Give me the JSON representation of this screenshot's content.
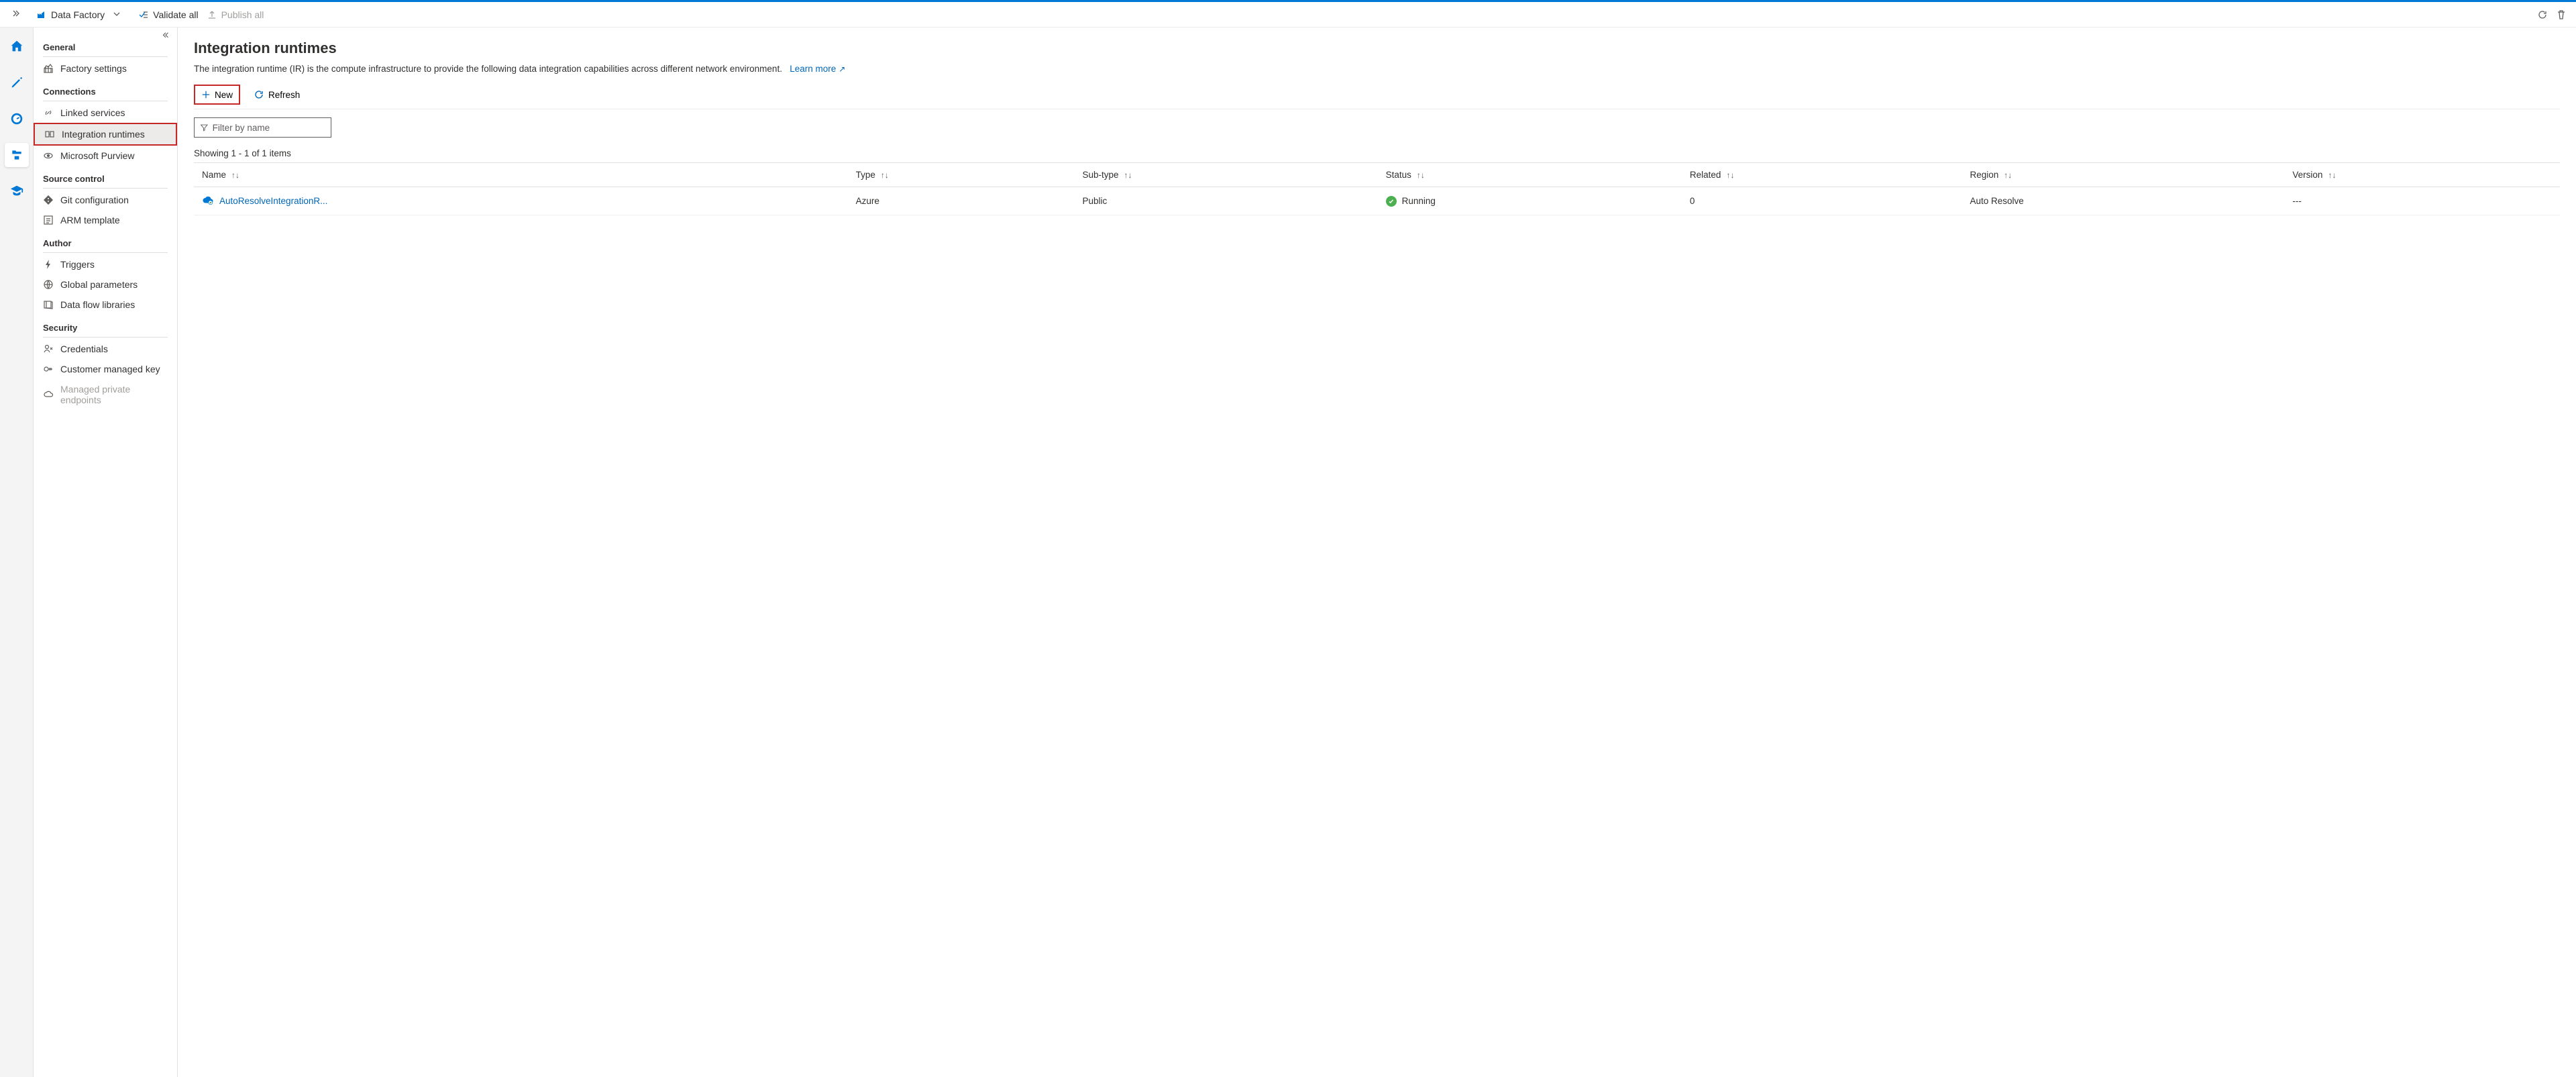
{
  "toolbar": {
    "context_label": "Data Factory",
    "validate_all": "Validate all",
    "publish_all": "Publish all"
  },
  "mgmt": {
    "sections": {
      "general": {
        "title": "General",
        "items": [
          "Factory settings"
        ]
      },
      "connections": {
        "title": "Connections",
        "items": [
          "Linked services",
          "Integration runtimes",
          "Microsoft Purview"
        ]
      },
      "source_control": {
        "title": "Source control",
        "items": [
          "Git configuration",
          "ARM template"
        ]
      },
      "author": {
        "title": "Author",
        "items": [
          "Triggers",
          "Global parameters",
          "Data flow libraries"
        ]
      },
      "security": {
        "title": "Security",
        "items": [
          "Credentials",
          "Customer managed key",
          "Managed private endpoints"
        ]
      }
    }
  },
  "page": {
    "title": "Integration runtimes",
    "description": "The integration runtime (IR) is the compute infrastructure to provide the following data integration capabilities across different network environment.",
    "learn_more": "Learn more"
  },
  "actions": {
    "new": "New",
    "refresh": "Refresh"
  },
  "filter": {
    "placeholder": "Filter by name"
  },
  "table": {
    "showing": "Showing 1 - 1 of 1 items",
    "columns": [
      "Name",
      "Type",
      "Sub-type",
      "Status",
      "Related",
      "Region",
      "Version"
    ],
    "rows": [
      {
        "name": "AutoResolveIntegrationR...",
        "type": "Azure",
        "subtype": "Public",
        "status": "Running",
        "related": "0",
        "region": "Auto Resolve",
        "version": "---"
      }
    ]
  }
}
